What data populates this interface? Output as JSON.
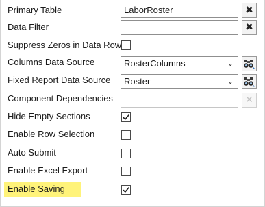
{
  "properties": {
    "primary_table": {
      "label": "Primary Table",
      "value": "LaborRoster"
    },
    "data_filter": {
      "label": "Data Filter",
      "value": ""
    },
    "suppress_zeros": {
      "label": "Suppress Zeros in Data Rows",
      "checked": false
    },
    "columns_data_source": {
      "label": "Columns Data Source",
      "value": "RosterColumns"
    },
    "fixed_report_data_source": {
      "label": "Fixed Report Data Source",
      "value": "Roster"
    },
    "component_dependencies": {
      "label": "Component Dependencies",
      "value": ""
    },
    "hide_empty_sections": {
      "label": "Hide Empty Sections",
      "checked": true
    },
    "enable_row_selection": {
      "label": "Enable Row Selection",
      "checked": false
    },
    "auto_submit": {
      "label": "Auto Submit",
      "checked": false
    },
    "enable_excel_export": {
      "label": "Enable Excel Export",
      "checked": false
    },
    "enable_saving": {
      "label": "Enable Saving",
      "checked": true
    }
  },
  "icons": {
    "clear": "close-icon",
    "browse": "binoculars-icon",
    "dropdown": "chevron-down-icon",
    "check": "checkmark-icon"
  },
  "colors": {
    "highlight": "#fff37a",
    "border": "#8f8f8f"
  }
}
